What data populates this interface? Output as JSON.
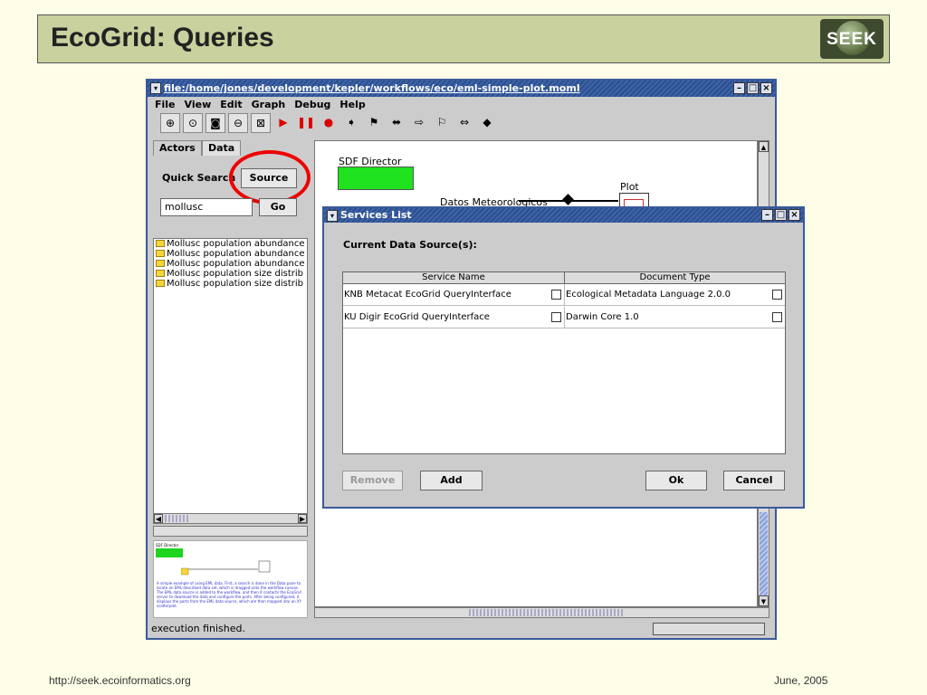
{
  "slide": {
    "title": "EcoGrid: Queries",
    "logo_text": "SEEK",
    "footer_left": "http://seek.ecoinformatics.org",
    "footer_right": "June, 2005"
  },
  "window": {
    "title": "file:/home/jones/development/kepler/workflows/eco/eml-simple-plot.moml",
    "menu": [
      "File",
      "View",
      "Edit",
      "Graph",
      "Debug",
      "Help"
    ],
    "toolbar_icons": [
      "zoom-in-icon",
      "zoom-reset-icon",
      "zoom-fit-icon",
      "zoom-out-icon",
      "fit-page-icon",
      "run-icon",
      "pause-icon",
      "stop-icon",
      "flag-right-icon",
      "flag-icon",
      "arrow-icon",
      "outline-arrow-icon",
      "outline-flag-icon",
      "outline-double-arrow-icon",
      "diamond-icon"
    ]
  },
  "left_pane": {
    "tabs": [
      "Actors",
      "Data"
    ],
    "quick_search_label": "Quick Search",
    "source_button": "Source",
    "search_value": "mollusc",
    "go_button": "Go",
    "results": [
      "Mollusc population abundance",
      "Mollusc population abundance",
      "Mollusc population abundance",
      "Mollusc population size distrib",
      "Mollusc population size distrib"
    ],
    "preview_director": "SDF Director",
    "preview_text": "A simple example of using EML data. First, a search is done in the Data pane to locate an EML-described data set, which is dragged onto the workflow canvas. The EML data source is added to the workflow, and then it contacts the EcoGrid server to download the data and configure the ports. After being configured, it displays the ports from the EML data source, which are then mapped into an XY scatterplot."
  },
  "canvas": {
    "director_label": "SDF Director",
    "source_label": "Datos Meteorologicos",
    "plot_label": "Plot"
  },
  "status": {
    "text": "execution finished."
  },
  "dialog": {
    "title": "Services List",
    "current_label": "Current Data Source(s):",
    "columns": [
      "Service Name",
      "Document Type"
    ],
    "rows": [
      {
        "service": "KNB Metacat EcoGrid QueryInterface",
        "doctype": "Ecological Metadata Language 2.0.0"
      },
      {
        "service": "KU Digir EcoGrid QueryInterface",
        "doctype": "Darwin Core 1.0"
      }
    ],
    "buttons": {
      "remove": "Remove",
      "add": "Add",
      "ok": "Ok",
      "cancel": "Cancel"
    }
  }
}
